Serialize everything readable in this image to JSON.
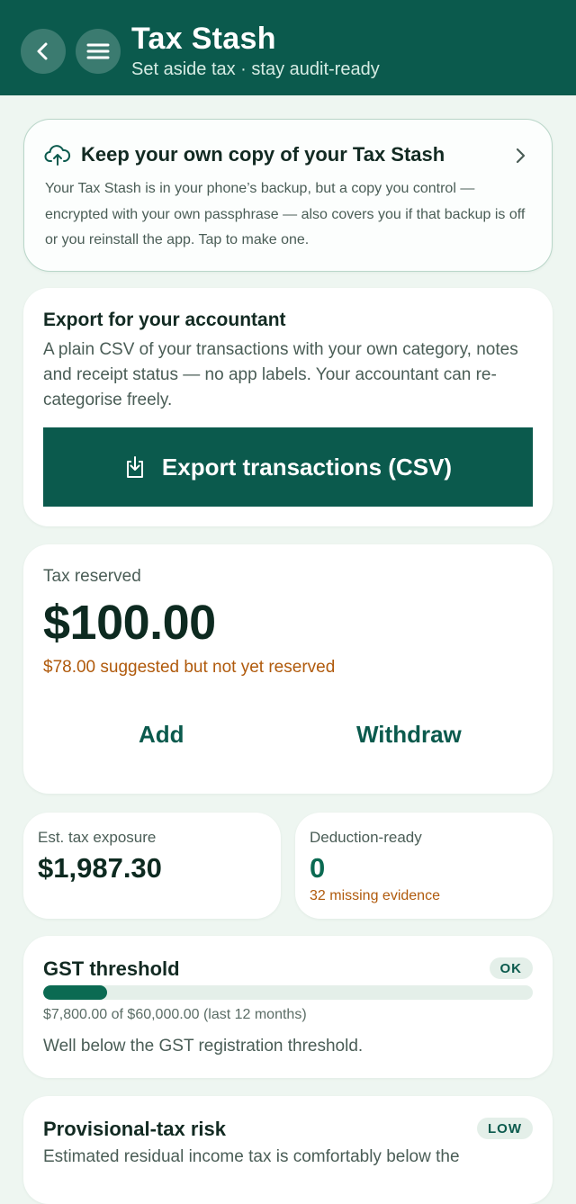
{
  "header": {
    "title": "Tax Stash",
    "subtitle": "Set aside tax · stay audit-ready",
    "back_icon": "chevron-left-icon",
    "menu_icon": "menu-icon"
  },
  "backup": {
    "icon": "cloud-upload-icon",
    "title": "Keep your own copy of your Tax Stash",
    "body": "Your Tax Stash is in your phone’s backup, but a copy you control — encrypted with your own passphrase — also covers you if that backup is off or you reinstall the app. Tap to make one."
  },
  "export": {
    "title": "Export for your accountant",
    "body": "A plain CSV of your transactions with your own category, notes and receipt status — no app labels. Your accountant can re-categorise freely.",
    "button_label": "Export transactions (CSV)"
  },
  "reserve": {
    "label": "Tax reserved",
    "amount": "$100.00",
    "note": "$78.00 suggested but not yet reserved",
    "add_label": "Add",
    "withdraw_label": "Withdraw"
  },
  "exposure": {
    "label": "Est. tax exposure",
    "value": "$1,987.30"
  },
  "deduction": {
    "label": "Deduction-ready",
    "value": "0",
    "note": "32 missing evidence"
  },
  "gst": {
    "title": "GST threshold",
    "badge": "OK",
    "progress_fraction": 0.13,
    "caption": "$7,800.00 of $60,000.00 (last 12 months)",
    "body": "Well below the GST registration threshold."
  },
  "provisional": {
    "title": "Provisional-tax risk",
    "badge": "LOW",
    "body": "Estimated residual income tax is comfortably below the"
  },
  "colors": {
    "brand": "#0b5a4d",
    "warning": "#b05a0c",
    "background": "#eef6f1"
  }
}
